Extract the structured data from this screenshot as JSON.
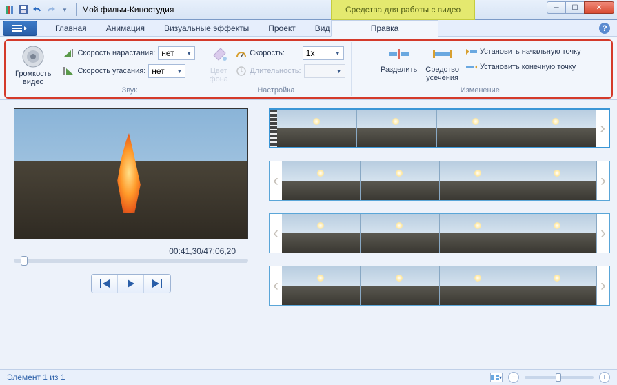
{
  "titlebar": {
    "project": "Мой фильм",
    "app": "Киностудия",
    "separator": " - ",
    "context_tools": "Средства для работы с видео"
  },
  "tabs": {
    "home": "Главная",
    "animation": "Анимация",
    "effects": "Визуальные эффекты",
    "project": "Проект",
    "view": "Вид",
    "edit": "Правка"
  },
  "ribbon": {
    "volume": {
      "label": "Громкость\nвидео"
    },
    "sound": {
      "fade_in_label": "Скорость нарастания:",
      "fade_in_value": "нет",
      "fade_out_label": "Скорость угасания:",
      "fade_out_value": "нет",
      "group": "Звук"
    },
    "adjust": {
      "bg_color": "Цвет\nфона",
      "speed_label": "Скорость:",
      "speed_value": "1x",
      "duration_label": "Длительность:",
      "duration_value": "",
      "group": "Настройка"
    },
    "change": {
      "split": "Разделить",
      "trim_tool": "Средство\nусечения",
      "set_start": "Установить начальную точку",
      "set_end": "Установить конечную точку",
      "group": "Изменение"
    }
  },
  "preview": {
    "time": "00:41,30/47:06,20"
  },
  "status": {
    "item_count": "Элемент 1 из 1"
  },
  "icons": {
    "help": "?"
  }
}
